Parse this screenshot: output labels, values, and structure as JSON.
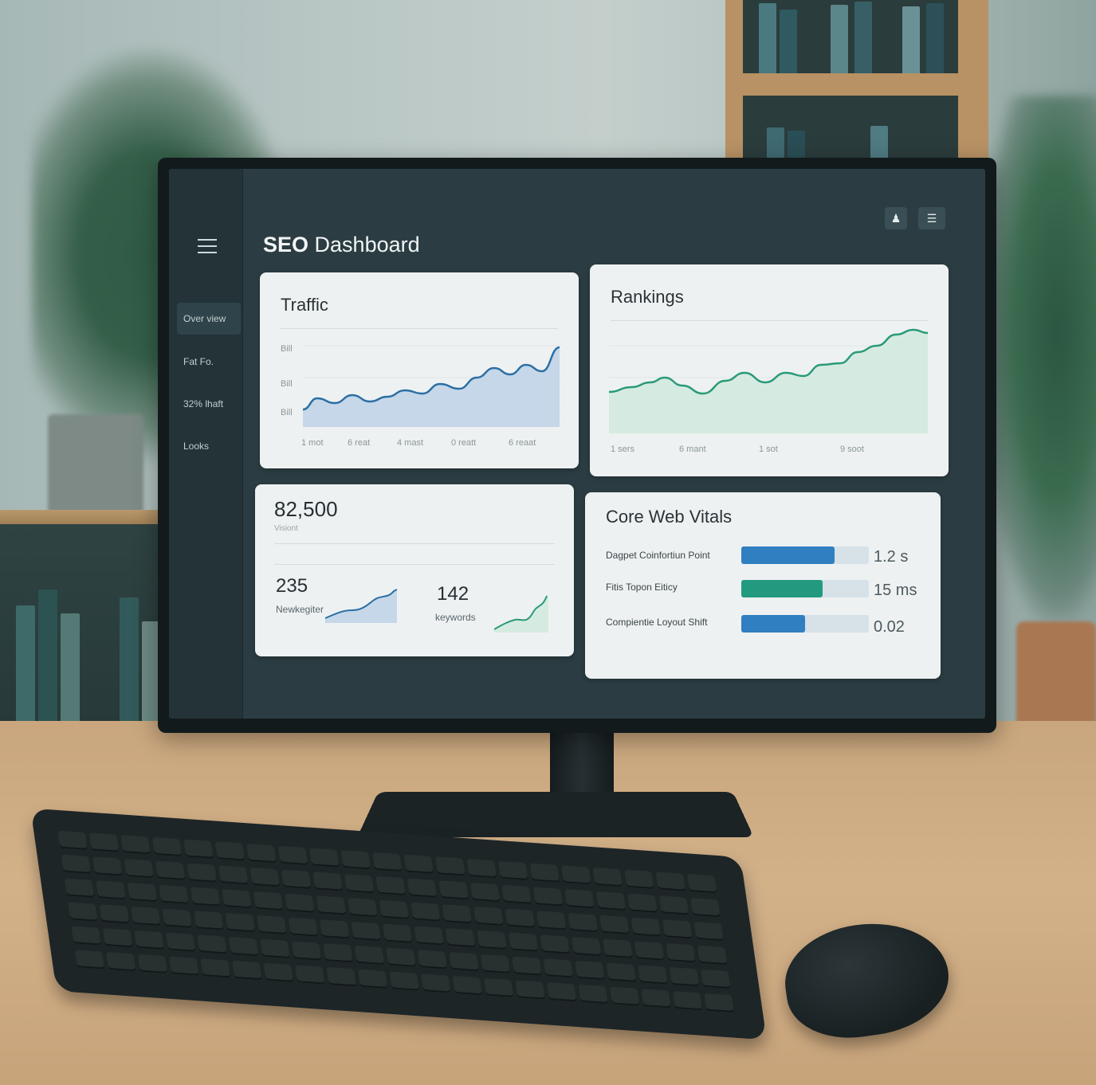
{
  "dashboard": {
    "title_bold": "SEO",
    "title_rest": " Dashboard"
  },
  "sidebar": {
    "items": [
      {
        "label": "Over view"
      },
      {
        "label": "Fat Fo."
      },
      {
        "label": "32% lhaft"
      },
      {
        "label": "Looks"
      }
    ]
  },
  "header_icons": [
    "user-icon",
    "menu-list-icon"
  ],
  "traffic": {
    "title": "Traffic",
    "y_ticks": [
      "Bill",
      "Bill",
      "Bill"
    ],
    "x_ticks": [
      "1 mot",
      "6 reat",
      "4 mast",
      "0 reatt",
      "6 reaat"
    ]
  },
  "rankings": {
    "title": "Rankings",
    "x_ticks": [
      "1 sers",
      "6 mant",
      "1 sot",
      "9 soot"
    ]
  },
  "summary": {
    "total_value": "82,500",
    "total_label": "Visiont",
    "stat1_value": "235",
    "stat1_label": "Newkegiter",
    "stat2_value": "142",
    "stat2_label": "keywords"
  },
  "vitals": {
    "title": "Core Web Vitals",
    "items": [
      {
        "label": "Dagpet Coinfortiun Point",
        "value": "1.2 s",
        "fill": 0.73,
        "color": "#2f7fc1"
      },
      {
        "label": "Fitis Topon Eiticy",
        "value": "15 ms",
        "fill": 0.64,
        "color": "#239a7f"
      },
      {
        "label": "Compientie Loyout Shift",
        "value": "0.02",
        "fill": 0.5,
        "color": "#2f7fc1"
      }
    ]
  },
  "colors": {
    "traffic_line": "#2c6fa4",
    "traffic_fill": "#c5d7e8",
    "rankings_line": "#2a9a78",
    "rankings_fill": "#d5ebe1"
  }
}
